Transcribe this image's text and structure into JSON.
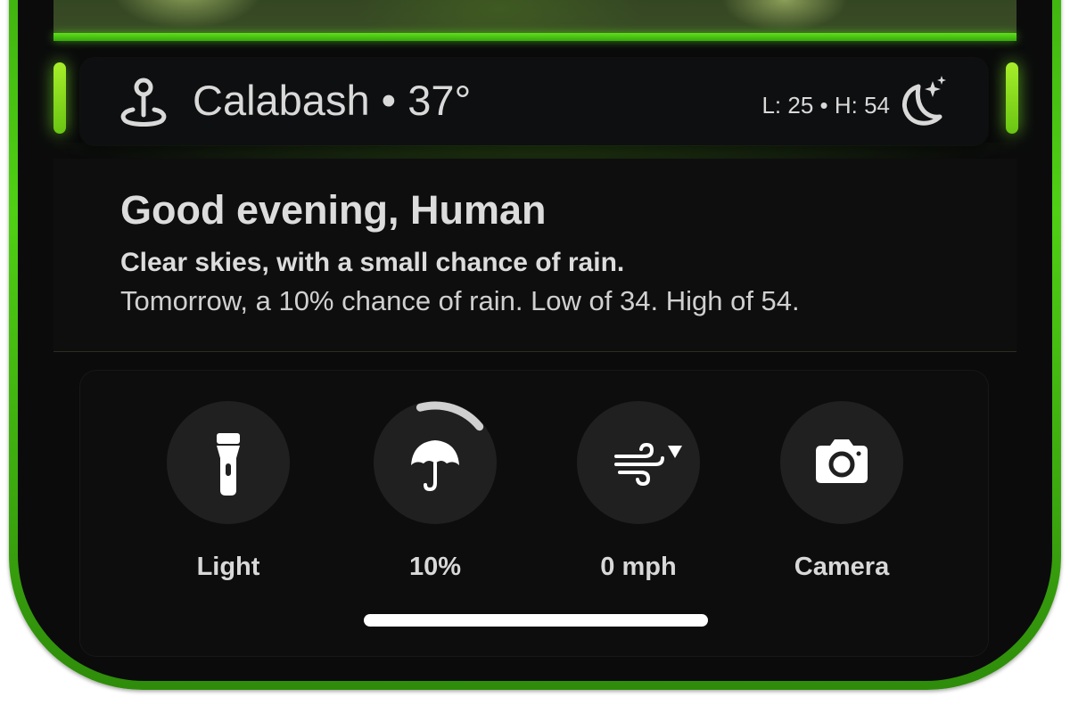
{
  "weather": {
    "location": "Calabash",
    "separator": "•",
    "temperature": "37°",
    "low_high": "L: 25 • H: 54",
    "condition_icon": "moon-stars-icon"
  },
  "greeting": {
    "title": "Good evening, Human",
    "summary": "Clear skies, with a small chance of rain.",
    "forecast": "Tomorrow, a 10% chance of rain. Low of 34. High of 54."
  },
  "controls": [
    {
      "id": "light",
      "label": "Light",
      "icon": "flashlight-icon"
    },
    {
      "id": "rain",
      "label": "10%",
      "icon": "umbrella-icon",
      "progress": 0.1
    },
    {
      "id": "wind",
      "label": "0 mph",
      "icon": "wind-icon"
    },
    {
      "id": "camera",
      "label": "Camera",
      "icon": "camera-icon"
    }
  ],
  "colors": {
    "accent_green": "#4fd014",
    "background": "#0b0b0c",
    "control_bg": "#202021",
    "text": "#d9d9d9"
  }
}
